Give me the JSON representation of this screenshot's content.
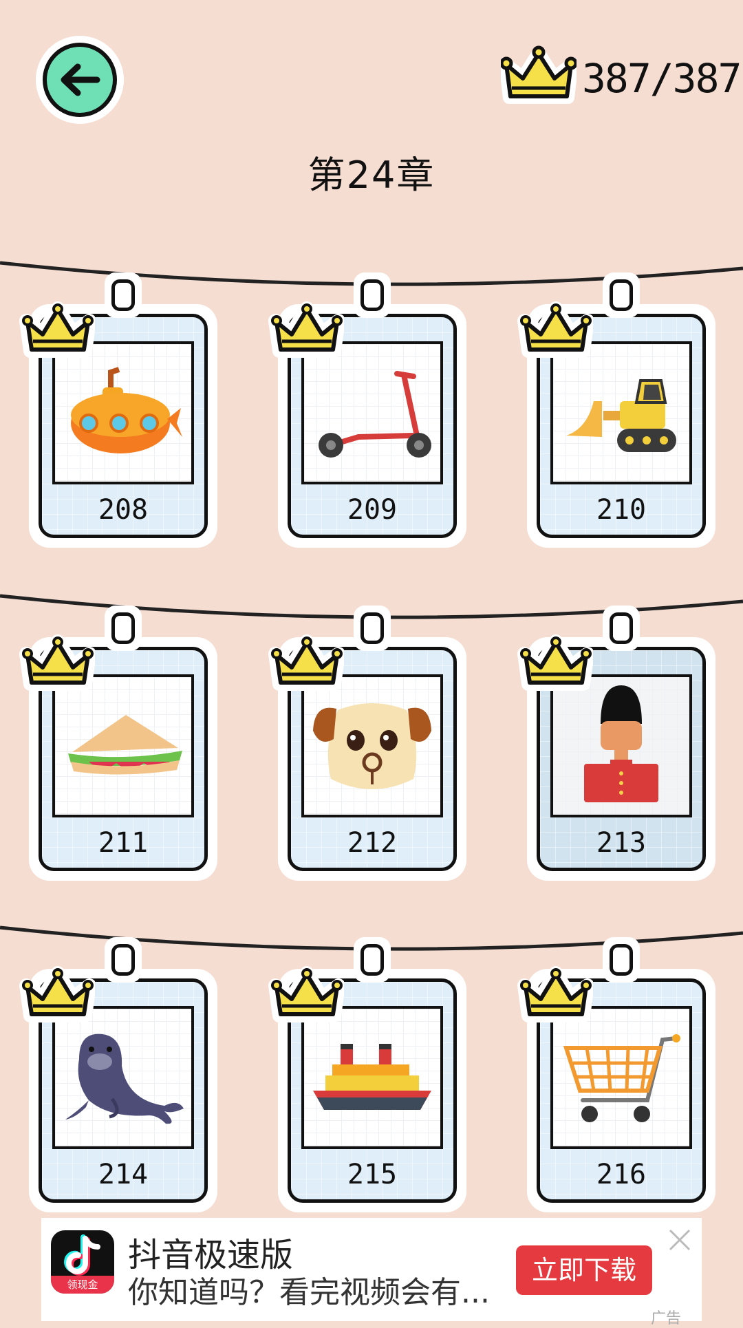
{
  "header": {
    "back_icon": "arrow-left-icon",
    "crown_icon": "crown-icon",
    "score": "387/387",
    "chapter_title": "第24章"
  },
  "levels": [
    {
      "number": "208",
      "picture": "submarine-icon",
      "completed": true
    },
    {
      "number": "209",
      "picture": "scooter-icon",
      "completed": true
    },
    {
      "number": "210",
      "picture": "bulldozer-icon",
      "completed": true
    },
    {
      "number": "211",
      "picture": "sandwich-icon",
      "completed": true
    },
    {
      "number": "212",
      "picture": "dog-icon",
      "completed": true
    },
    {
      "number": "213",
      "picture": "royal-guard-icon",
      "completed": true
    },
    {
      "number": "214",
      "picture": "seal-icon",
      "completed": true
    },
    {
      "number": "215",
      "picture": "cruise-ship-icon",
      "completed": true
    },
    {
      "number": "216",
      "picture": "shopping-cart-icon",
      "completed": true
    }
  ],
  "ad": {
    "app_name": "抖音极速版",
    "description": "你知道吗？看完视频会有...",
    "cta": "立即下载",
    "icon_badge": "领现金",
    "label": "广告"
  },
  "colors": {
    "background": "#f6ddd2",
    "back_button": "#6fe0b6",
    "crown": "#f6e04a",
    "card_paper": "#dfeef8",
    "ad_button": "#e53a3f"
  }
}
